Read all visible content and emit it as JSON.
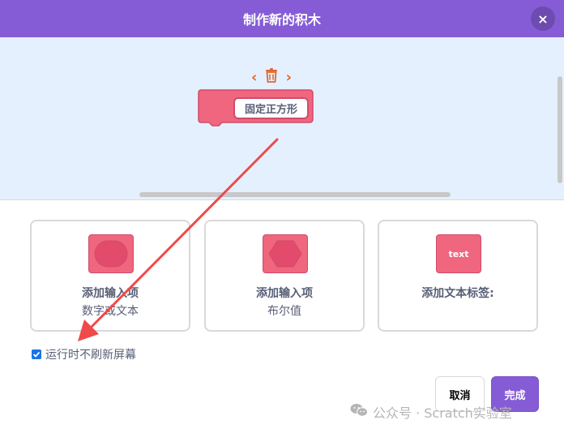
{
  "dialog": {
    "title": "制作新的积木",
    "close_glyph": "×"
  },
  "preview": {
    "block_label": "固定正方形",
    "block_color": "#f0667f",
    "tool_left": "‹",
    "tool_right": "›"
  },
  "options": [
    {
      "line1": "添加输入项",
      "line2": "数字或文本",
      "icon": "round-input-icon"
    },
    {
      "line1": "添加输入项",
      "line2": "布尔值",
      "icon": "hexagon-input-icon"
    },
    {
      "line1": "添加文本标签:",
      "line2": "",
      "icon": "text-label-icon",
      "icon_text": "text"
    }
  ],
  "run_without_refresh": {
    "label": "运行时不刷新屏幕",
    "checked": true
  },
  "buttons": {
    "cancel": "取消",
    "ok": "完成"
  },
  "watermark": {
    "text": "公众号 · Scratch实验室"
  },
  "colors": {
    "header": "#855cd6",
    "workspace": "#e5f0ff",
    "block": "#f0667f",
    "arrow": "#ef4a4a"
  }
}
